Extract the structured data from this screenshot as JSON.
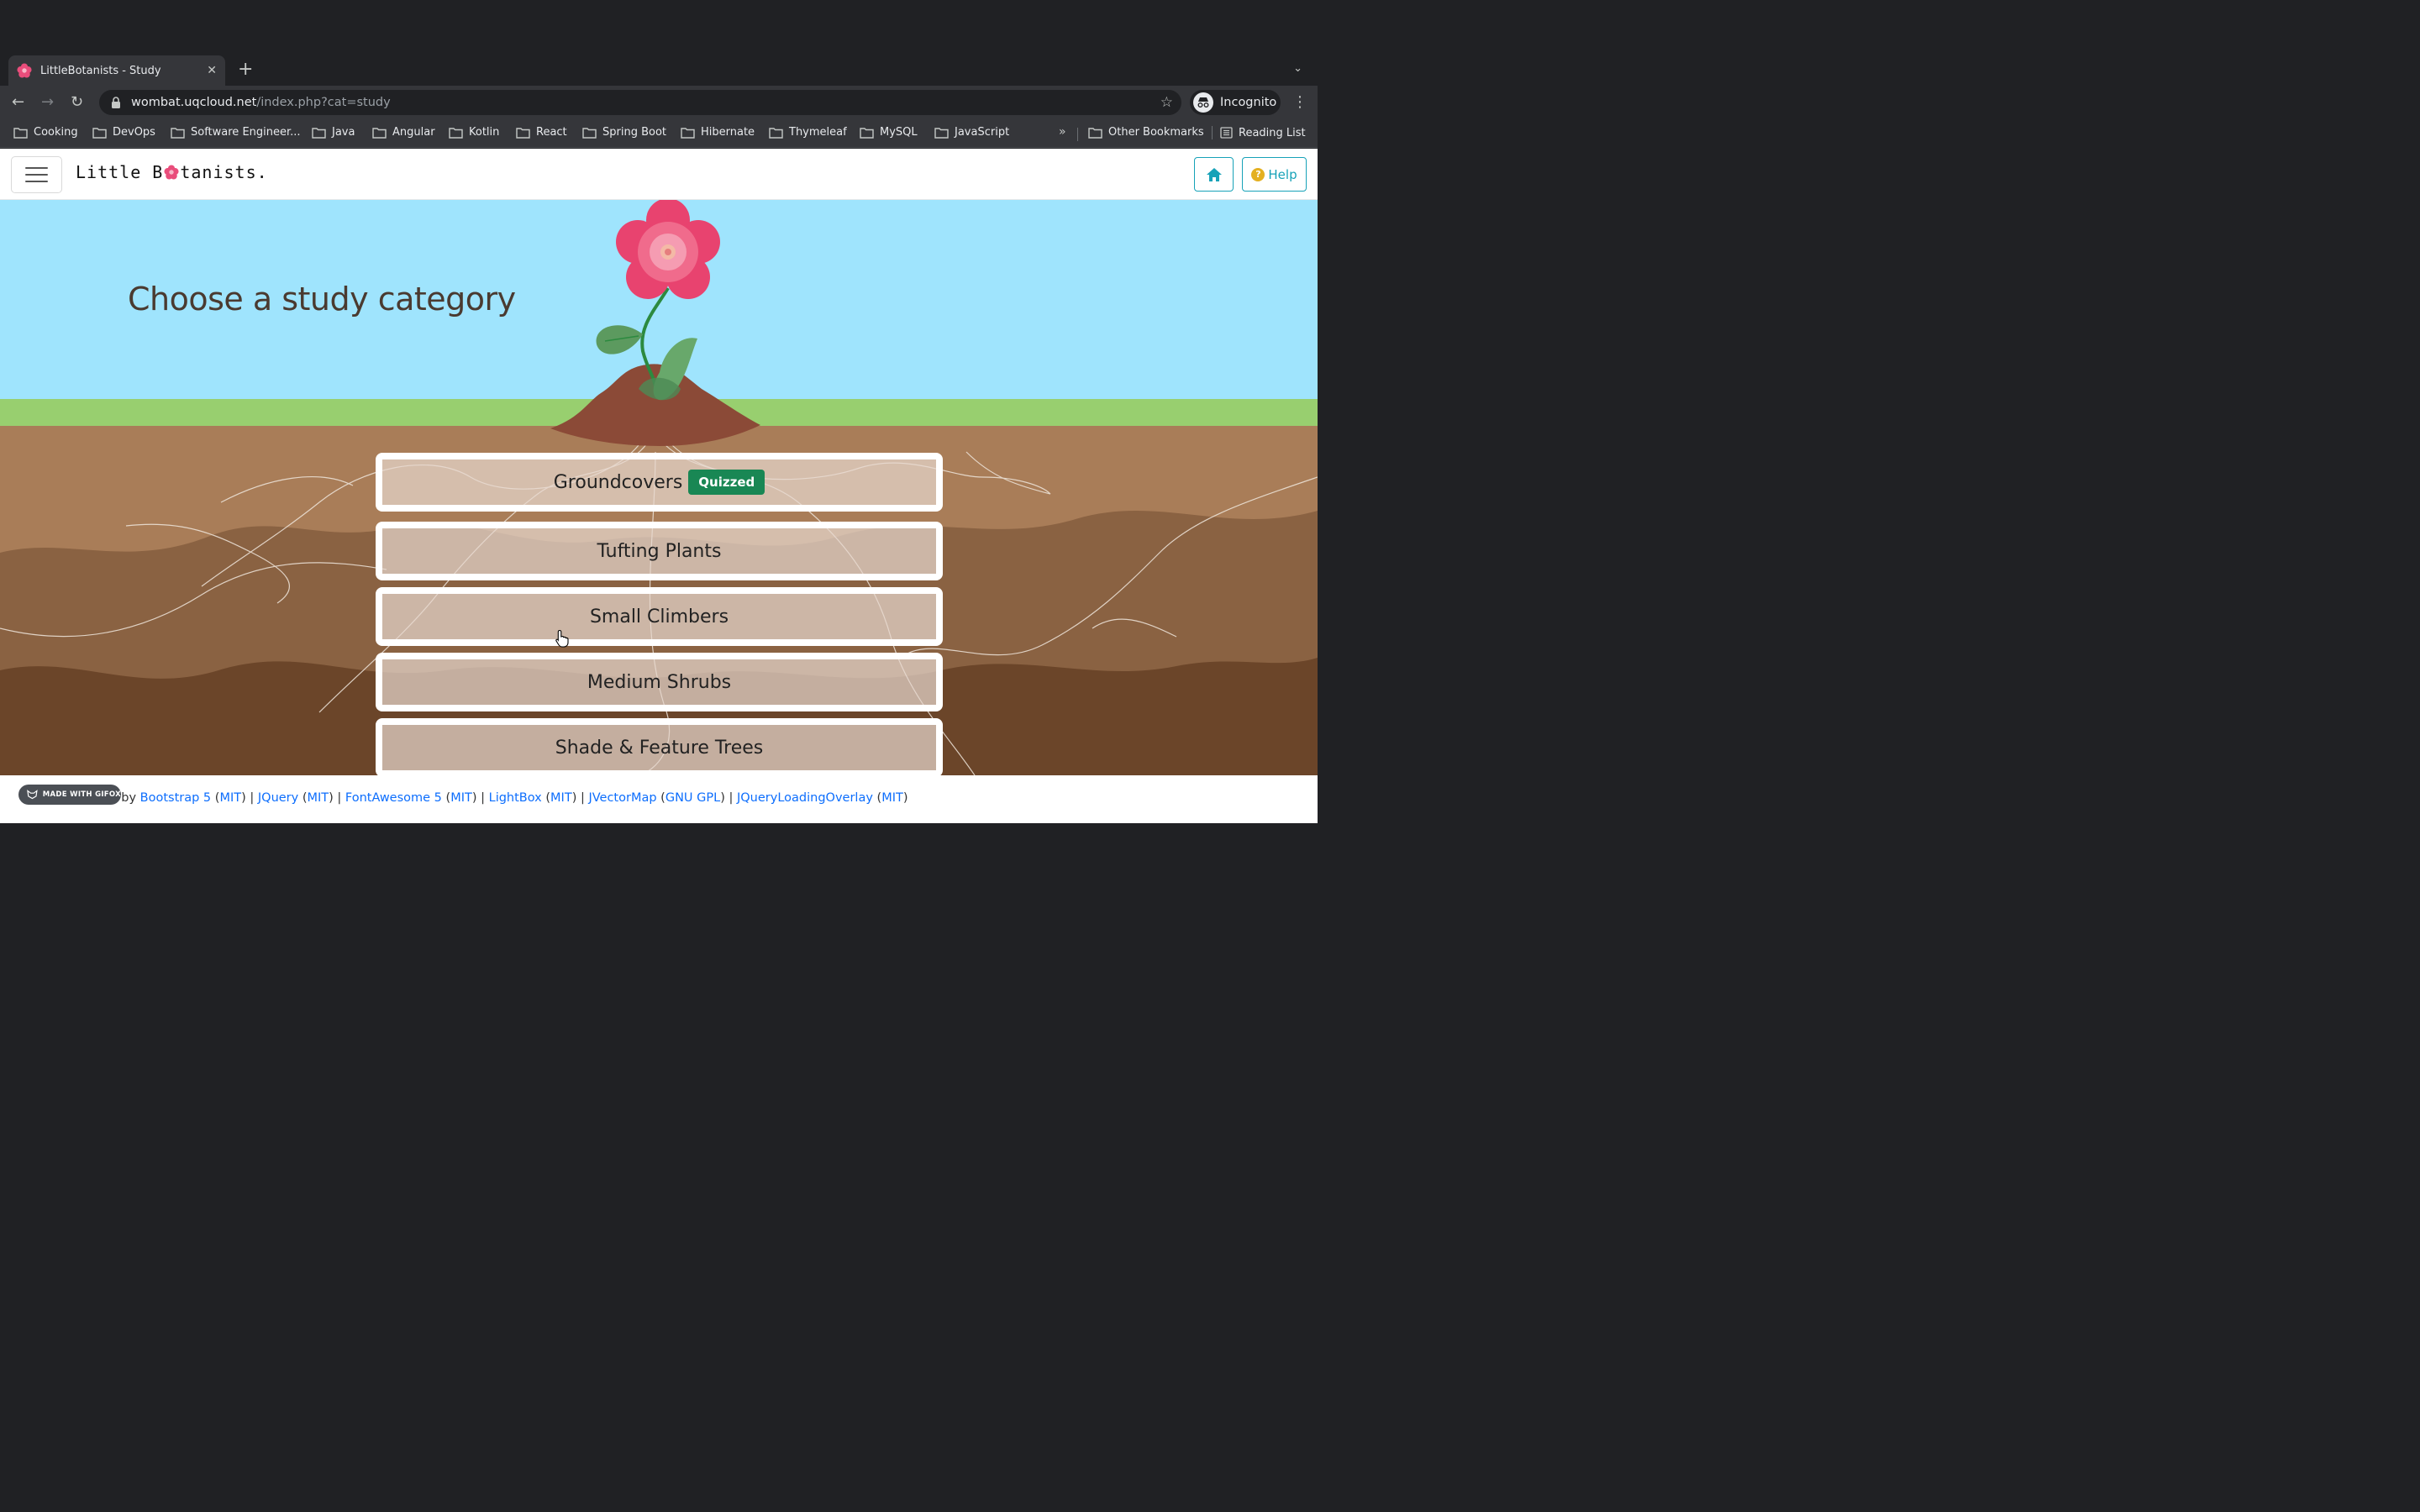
{
  "browser": {
    "tab_title": "LittleBotanists - Study",
    "url_host": "wombat.uqcloud.net",
    "url_path": "/index.php?cat=study",
    "profile_label": "Incognito",
    "bookmarks": [
      "Cooking",
      "DevOps",
      "Software Engineer...",
      "Java",
      "Angular",
      "Kotlin",
      "React",
      "Spring Boot",
      "Hibernate",
      "Thymeleaf",
      "MySQL",
      "JavaScript"
    ],
    "more_symbol": "»",
    "other_bookmarks": "Other Bookmarks",
    "reading_list": "Reading List"
  },
  "navbar": {
    "brand_before": "Little B",
    "brand_after": "tanists.",
    "help_label": "Help"
  },
  "hero": {
    "title": "Choose a study category"
  },
  "categories": [
    {
      "label": "Groundcovers",
      "badge": "Quizzed"
    },
    {
      "label": "Tufting Plants"
    },
    {
      "label": "Small Climbers"
    },
    {
      "label": "Medium Shrubs"
    },
    {
      "label": "Shade & Feature Trees"
    }
  ],
  "footer": {
    "powered_by": "Powered by",
    "libs": [
      {
        "name": "Bootstrap 5",
        "license": "MIT"
      },
      {
        "name": "JQuery",
        "license": "MIT"
      },
      {
        "name": "FontAwesome 5",
        "license": "MIT"
      },
      {
        "name": "LightBox",
        "license": "MIT"
      },
      {
        "name": "JVectorMap",
        "license": "GNU GPL"
      },
      {
        "name": "JQueryLoadingOverlay",
        "license": "MIT"
      }
    ],
    "gifox_label": "MADE WITH GIFOX"
  },
  "colors": {
    "sky": "#9fe4fd",
    "grass": "#98cf6f",
    "soil": "#a97d58",
    "badge": "#198754",
    "accent": "#17a2b8"
  },
  "icons": [
    "flower-favicon-icon",
    "close-icon",
    "plus-icon",
    "back-icon",
    "forward-icon",
    "reload-icon",
    "lock-icon",
    "star-icon",
    "incognito-icon",
    "kebab-icon",
    "folder-icon",
    "reading-list-icon",
    "hamburger-icon",
    "home-icon",
    "question-icon",
    "hand-cursor-icon"
  ]
}
